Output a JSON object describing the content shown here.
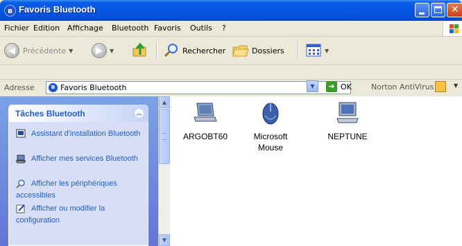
{
  "window": {
    "title": "Favoris Bluetooth"
  },
  "menu": {
    "items": [
      "Fichier",
      "Edition",
      "Affichage",
      "Bluetooth",
      "Favoris",
      "Outils",
      "?"
    ]
  },
  "toolbar": {
    "back_label": "Précédente",
    "search_label": "Rechercher",
    "folders_label": "Dossiers"
  },
  "addressbar": {
    "label": "Adresse",
    "value": "Favoris Bluetooth",
    "go_label": "OK",
    "norton_label": "Norton AntiVirus"
  },
  "tasks": {
    "title": "Tâches Bluetooth",
    "items": [
      {
        "label": "Assistant d'installation Bluetooth",
        "icon": "wizard-icon"
      },
      {
        "label": "Afficher mes services Bluetooth",
        "icon": "services-icon"
      },
      {
        "label": "Afficher les périphériques accessibles",
        "icon": "search-devices-icon"
      },
      {
        "label": "Afficher ou modifier la configuration",
        "icon": "configuration-icon"
      }
    ]
  },
  "devices": [
    {
      "name": "ARGOBT60",
      "icon": "laptop-icon"
    },
    {
      "name": "Microsoft Mouse",
      "icon": "mouse-icon"
    },
    {
      "name": "NEPTUNE",
      "icon": "desktop-computer-icon"
    }
  ]
}
